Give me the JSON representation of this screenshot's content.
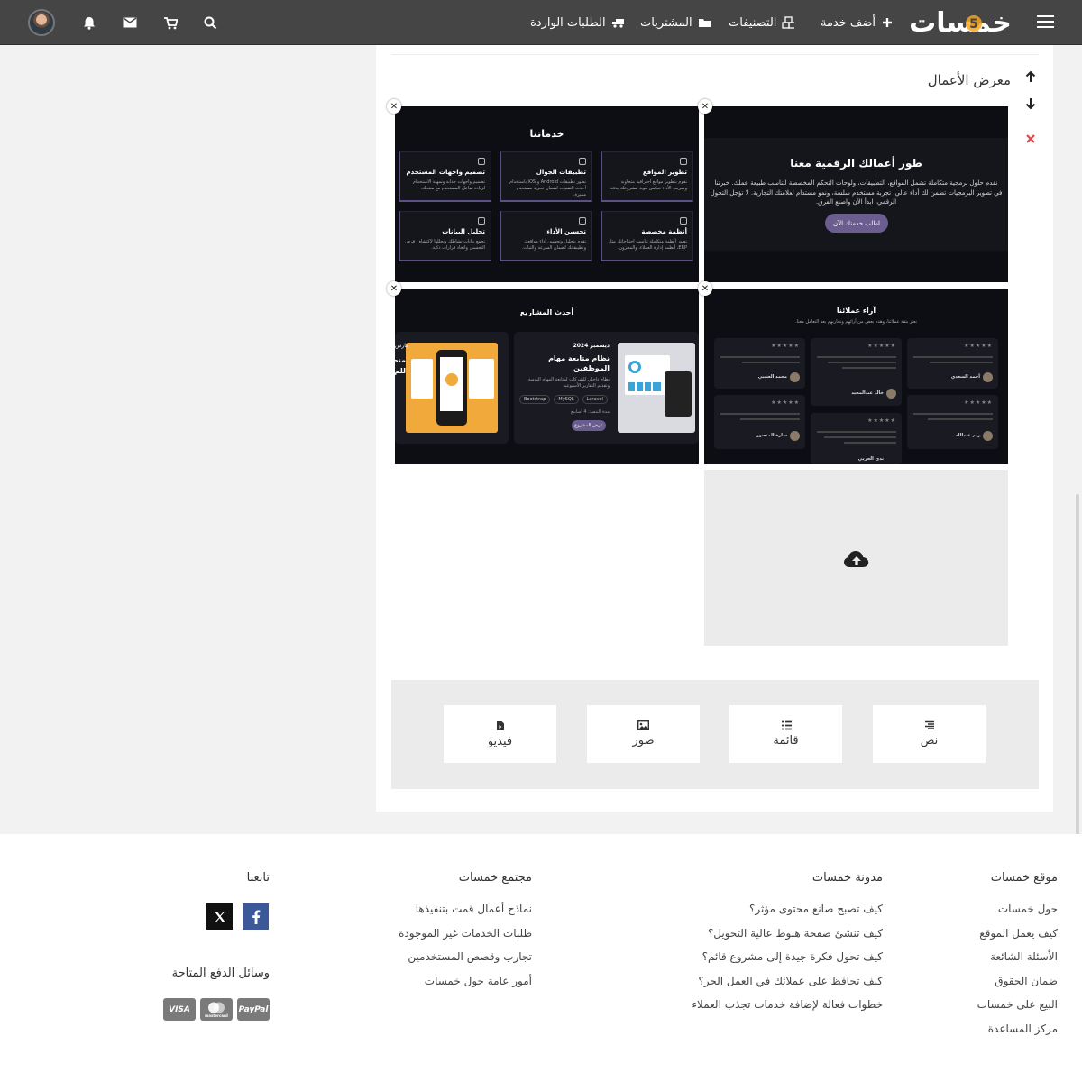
{
  "header": {
    "logo_text": "خمسات",
    "nav": [
      {
        "label": "أضف خدمة",
        "icon": "plus-icon"
      },
      {
        "label": "التصنيفات",
        "icon": "cubes-icon"
      },
      {
        "label": "المشتريات",
        "icon": "folder-open-icon"
      },
      {
        "label": "الطلبات الواردة",
        "icon": "truck-icon"
      }
    ],
    "icons": [
      "search-icon",
      "cart-icon",
      "envelope-icon",
      "bell-icon"
    ]
  },
  "portfolio": {
    "title": "معرض الأعمال",
    "tile1": {
      "heading": "طور أعمالك الرقمية معنا",
      "text": "نقدم حلول برمجية متكاملة تشمل المواقع، التطبيقات، ولوحات التحكم المخصصة لتناسب طبيعة عملك. خبرتنا في تطوير البرمجيات تضمن لك أداء عالي، تجربة مستخدم سلسة، ونمو مستدام لعلامتك التجارية. لا تؤجل التحول الرقمي، ابدأ الآن واصنع الفرق.",
      "button": "اطلب خدمتك الآن"
    },
    "tile2": {
      "heading": "خدماتنا",
      "services": [
        {
          "title": "تطوير المواقع",
          "desc": "نقوم بتطوير مواقع احترافية متجاوبة وسريعة الأداء تعكس هوية مشروعك بدقة."
        },
        {
          "title": "تطبيقات الجوال",
          "desc": "نطور تطبيقات Android و iOS باستخدام أحدث التقنيات لضمان تجربة مستخدم مميزة."
        },
        {
          "title": "تصميم واجهات المستخدم",
          "desc": "تصميم واجهات جذابة وسهلة الاستخدام لزيادة تفاعل المستخدم مع منتجك."
        },
        {
          "title": "أنظمة مخصصة",
          "desc": "نطور أنظمة متكاملة تناسب احتياجاتك مثل ERP، أنظمة إدارة العملاء، والمخزون."
        },
        {
          "title": "تحسين الأداء",
          "desc": "نقوم بتحليل وتحسين أداء مواقعك وتطبيقاتك لضمان السرعة والثبات."
        },
        {
          "title": "تحليل البيانات",
          "desc": "نجمع بيانات نشاطك ونحللها لاكتشاف فرص التحسين واتخاذ قرارات ذكية."
        }
      ]
    },
    "tile3": {
      "heading": "آراء عملائنا",
      "subheading": "نعتز بثقة عملائنا، وهذه بعض من آرائهم وتجاربهم بعد التعامل معنا.",
      "reviewers": [
        {
          "name": "أحمد السعدي",
          "role": "مدير التسويق"
        },
        {
          "name": "خالد عبدالمجيد",
          "role": "مؤسس منصة أونلاين"
        },
        {
          "name": "محمد العتيبي",
          "role": "مدير تقنية المعلومات"
        },
        {
          "name": "ريم عبدالله",
          "role": "مؤسسة متجر إلكتروني"
        },
        {
          "name": "ندى الحربي",
          "role": "مصممة"
        },
        {
          "name": "سارة المنصور",
          "role": "رئيس تنفيذي"
        }
      ],
      "stars": "★★★★★"
    },
    "tile4": {
      "heading": "أحدث المشاريع",
      "project_date": "ديسمبر 2024",
      "project_title": "نظام متابعة مهام الموظفين",
      "project_desc": "نظام داخلي للشركات لمتابعة المهام اليومية وتقديم التقارير الأسبوعية",
      "tags": [
        "Laravel",
        "MySQL",
        "Bootstrap"
      ],
      "duration": "مدة التنفيذ: 4 أسابيع",
      "button": "عرض المشروع",
      "second_date": "مارس",
      "second_title": "منص للم"
    }
  },
  "add_types": [
    {
      "label": "نص",
      "icon": "align-right-icon"
    },
    {
      "label": "قائمة",
      "icon": "list-icon"
    },
    {
      "label": "صور",
      "icon": "image-icon"
    },
    {
      "label": "فيديو",
      "icon": "video-file-icon"
    }
  ],
  "footer": {
    "col1": {
      "title": "موقع خمسات",
      "links": [
        "حول خمسات",
        "كيف يعمل الموقع",
        "الأسئلة الشائعة",
        "ضمان الحقوق",
        "البيع على خمسات",
        "مركز المساعدة"
      ]
    },
    "col2": {
      "title": "مدونة خمسات",
      "links": [
        "كيف تصبح صانع محتوى مؤثر؟",
        "كيف تنشئ صفحة هبوط عالية التحويل؟",
        "كيف تحول فكرة جيدة إلى مشروع قائم؟",
        "كيف تحافظ على عملائك في العمل الحر؟",
        "خطوات فعالة لإضافة خدمات تجذب العملاء"
      ]
    },
    "col3": {
      "title": "مجتمع خمسات",
      "links": [
        "نماذج أعمال قمت بتنفيذها",
        "طلبات الخدمات غير الموجودة",
        "تجارب وقصص المستخدمين",
        "أمور عامة حول خمسات"
      ]
    },
    "col4": {
      "title": "تابعنا",
      "payments_title": "وسائل الدفع المتاحة",
      "payments": [
        "VISA",
        "mastercard",
        "PayPal"
      ]
    }
  }
}
